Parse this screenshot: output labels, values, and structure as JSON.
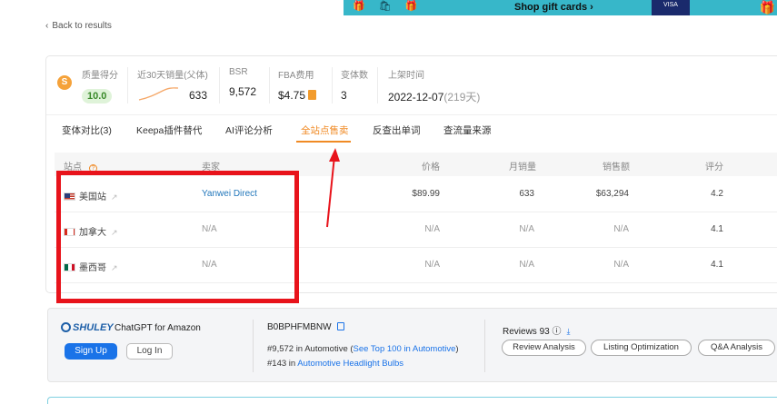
{
  "banner": {
    "gift_deco": "🎁 🛍 🎁",
    "shop_label": "Shop gift cards ›",
    "visa_label": "VISA",
    "gift_right": "🎁"
  },
  "back_link": {
    "chevron": "‹",
    "label": "Back to results"
  },
  "metrics": {
    "logo": "S",
    "quality": {
      "label": "质量得分",
      "value": "10.0"
    },
    "sales30": {
      "label": "近30天销量(父体)",
      "value": "633"
    },
    "bsr": {
      "label": "BSR",
      "value": "9,572"
    },
    "fba": {
      "label": "FBA费用",
      "value": "$4.75"
    },
    "variants": {
      "label": "变体数",
      "value": "3"
    },
    "launch": {
      "label": "上架时间",
      "value": "2022-12-07",
      "days": "(219天)"
    }
  },
  "tabs": [
    "变体对比(3)",
    "Keepa插件替代",
    "AI评论分析",
    "全站点售卖",
    "反查出单词",
    "查流量来源"
  ],
  "table": {
    "headers": {
      "site": "站点",
      "help": "?",
      "seller": "卖家",
      "price": "价格",
      "monthly": "月销量",
      "revenue": "销售额",
      "rating": "评分"
    },
    "rows": [
      {
        "flag": "us",
        "site": "美国站",
        "seller": "Yanwei Direct",
        "price": "$89.99",
        "monthly": "633",
        "revenue": "$63,294",
        "rating": "4.2"
      },
      {
        "flag": "ca",
        "site": "加拿大",
        "seller": "N/A",
        "price": "N/A",
        "monthly": "N/A",
        "revenue": "N/A",
        "rating": "4.1"
      },
      {
        "flag": "mx",
        "site": "墨西哥",
        "seller": "N/A",
        "price": "N/A",
        "monthly": "N/A",
        "revenue": "N/A",
        "rating": "4.1"
      }
    ],
    "ext_icon": "↗"
  },
  "shuley": {
    "brand": "SHULEY",
    "tagline": "ChatGPT for Amazon",
    "signup": "Sign Up",
    "login": "Log In",
    "asin": "B0BPHFMBNW",
    "rank1_prefix": "#9,572 in Automotive (",
    "rank1_link": "See Top 100 in Automotive",
    "rank1_suffix": ")",
    "rank2_prefix": "#143 in ",
    "rank2_link": "Automotive Headlight Bulbs",
    "reviews_label": "Reviews 93",
    "info_icon": "ⓘ",
    "download_icon": "⤓",
    "pills": [
      "Review Analysis",
      "Listing Optimization",
      "Q&A Analysis"
    ]
  },
  "colors": {
    "accent": "#f08a24",
    "link": "#2277bb",
    "annotation": "#e8131b",
    "signup": "#1a73e8"
  }
}
